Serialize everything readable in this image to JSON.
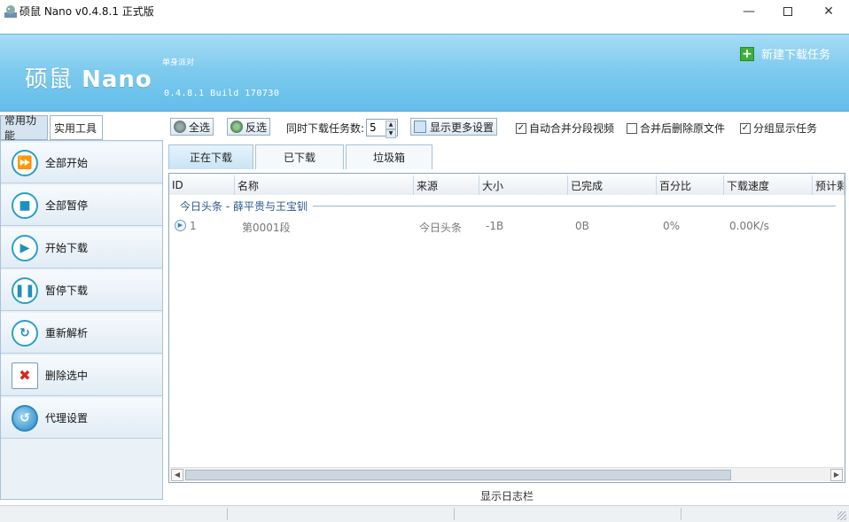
{
  "window": {
    "title": "硕鼠 Nano v0.4.8.1 正式版"
  },
  "banner": {
    "logo_cn": "硕鼠",
    "logo_en": "Nano",
    "tagline": "单身派对",
    "version": "0.4.8.1 Build 170730",
    "new_task": "新建下载任务"
  },
  "left_tabs": [
    "常用功能",
    "实用工具"
  ],
  "sidebar": {
    "items": [
      {
        "label": "全部开始",
        "icon": "fast-forward-icon"
      },
      {
        "label": "全部暂停",
        "icon": "stop-icon"
      },
      {
        "label": "开始下载",
        "icon": "play-icon"
      },
      {
        "label": "暂停下载",
        "icon": "pause-icon"
      },
      {
        "label": "重新解析",
        "icon": "refresh-icon"
      },
      {
        "label": "删除选中",
        "icon": "delete-doc-icon"
      },
      {
        "label": "代理设置",
        "icon": "globe-icon"
      }
    ]
  },
  "toolbar": {
    "select_all": "全选",
    "invert": "反选",
    "concurrent_label": "同时下载任务数:",
    "concurrent_value": "5",
    "more_settings": "显示更多设置",
    "auto_merge": "自动合并分段视频",
    "delete_after_merge": "合并后删除原文件",
    "group_display": "分组显示任务"
  },
  "tabs": [
    "正在下载",
    "已下载",
    "垃圾箱"
  ],
  "columns": [
    "ID",
    "名称",
    "来源",
    "大小",
    "已完成",
    "百分比",
    "下载速度",
    "预计剩余"
  ],
  "group": {
    "title": "今日头条 - 薛平贵与王宝钏"
  },
  "rows": [
    {
      "id": "1",
      "name": "第0001段",
      "source": "今日头条",
      "size": "-1B",
      "done": "0B",
      "percent": "0%",
      "speed": "0.00K/s"
    }
  ],
  "log_bar": "显示日志栏",
  "colors": {
    "banner_top": "#a7dcf4",
    "banner_bottom": "#62bdea",
    "accent_green": "#3fae3b"
  }
}
